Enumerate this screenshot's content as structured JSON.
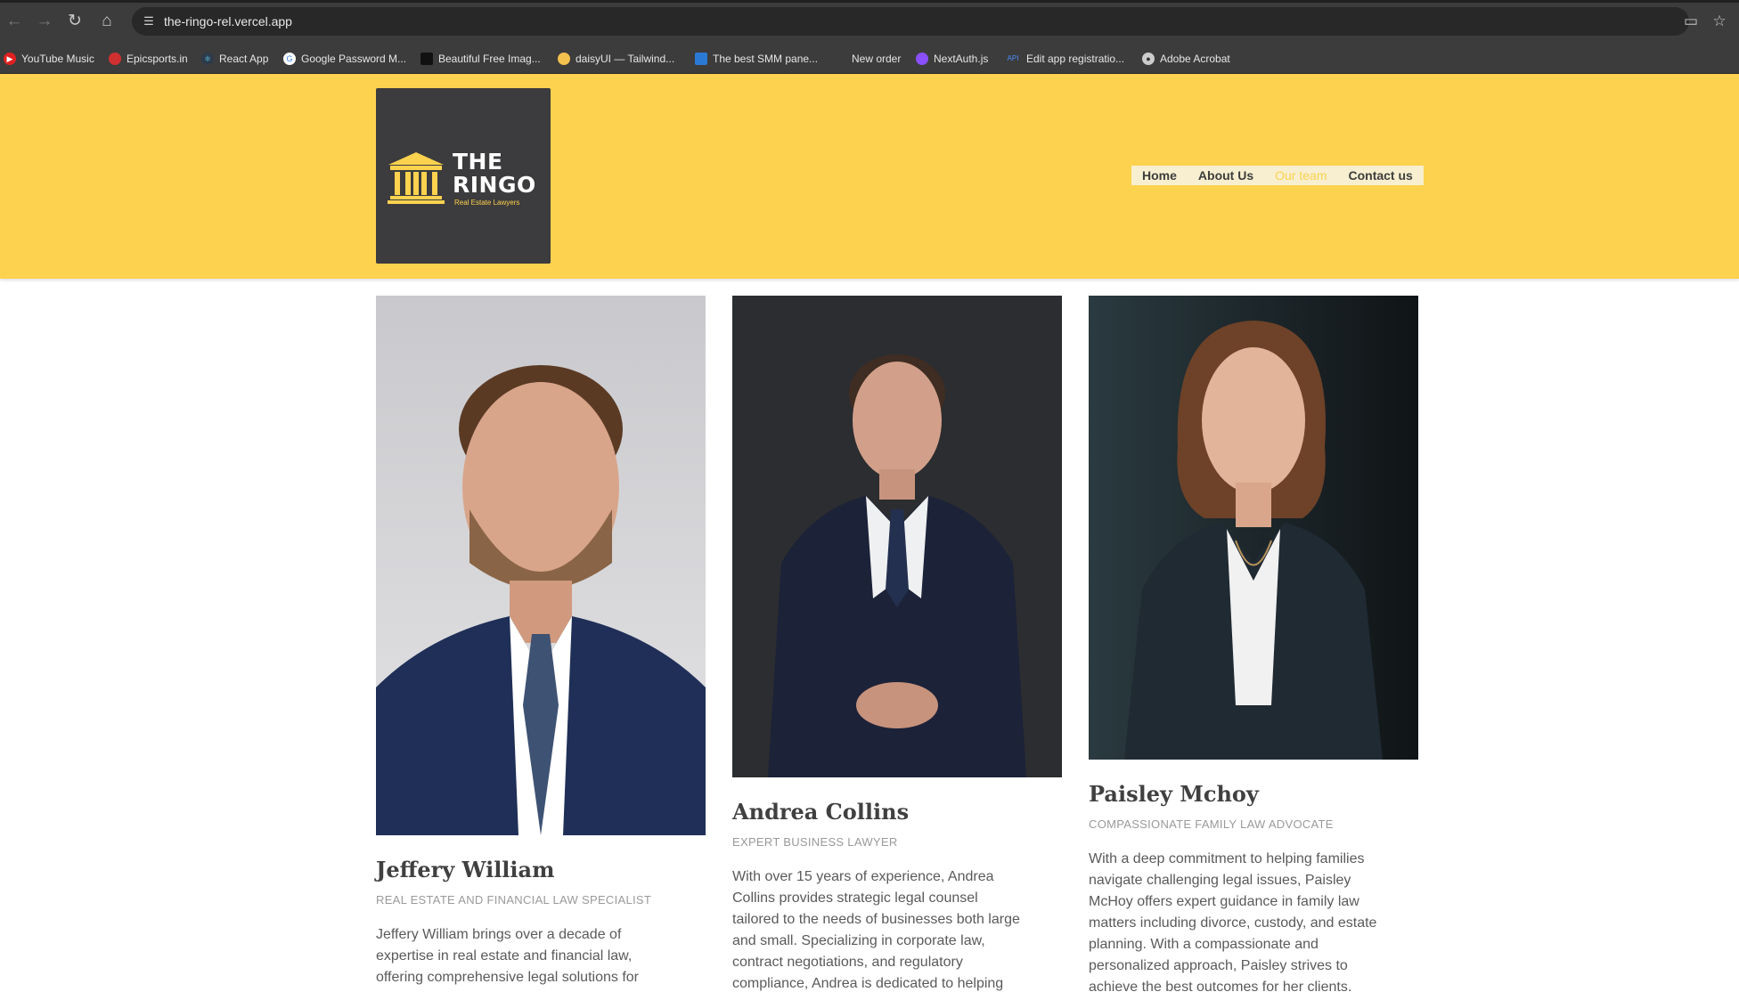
{
  "browser": {
    "url": "the-ringo-rel.vercel.app",
    "back_icon": "arrow-left-icon",
    "forward_icon": "arrow-right-icon",
    "reload_icon": "reload-icon",
    "home_icon": "home-icon"
  },
  "bookmarks": [
    {
      "label": "YouTube Music",
      "color": "#e02020"
    },
    {
      "label": "Epicsports.in",
      "color": "#d03030"
    },
    {
      "label": "React App",
      "color": "#3a6ea5"
    },
    {
      "label": "Google Password M...",
      "color": "#ffffff"
    },
    {
      "label": "Beautiful Free Imag...",
      "color": "#222222"
    },
    {
      "label": "daisyUI — Tailwind...",
      "color": "#f2c14e"
    },
    {
      "label": "The best SMM pane...",
      "color": "#2a7ad5"
    },
    {
      "label": "New order",
      "color": ""
    },
    {
      "label": "NextAuth.js",
      "color": "#8a4fff"
    },
    {
      "label": "Edit app registratio...",
      "color": "#4a8cff"
    },
    {
      "label": "Adobe Acrobat",
      "color": "#cccccc"
    }
  ],
  "header": {
    "brand_line1": "THE",
    "brand_line2": "RINGO",
    "tagline": "Real Estate Lawyers",
    "accent_color": "#fcd24f",
    "logo_bg": "#3c3b3d"
  },
  "nav": [
    {
      "label": "Home",
      "active": false
    },
    {
      "label": "About Us",
      "active": false
    },
    {
      "label": "Our team",
      "active": true
    },
    {
      "label": "Contact us",
      "active": false
    }
  ],
  "team": [
    {
      "name": "Jeffery William",
      "role": "REAL ESTATE AND FINANCIAL LAW SPECIALIST",
      "bio": "Jeffery William brings over a decade of expertise in real estate and financial law, offering comprehensive legal solutions for"
    },
    {
      "name": "Andrea Collins",
      "role": "EXPERT BUSINESS LAWYER",
      "bio": "With over 15 years of experience, Andrea Collins provides strategic legal counsel tailored to the needs of businesses both large and small. Specializing in corporate law, contract negotiations, and regulatory compliance, Andrea is dedicated to helping"
    },
    {
      "name": "Paisley Mchoy",
      "role": "COMPASSIONATE FAMILY LAW ADVOCATE",
      "bio": "With a deep commitment to helping families navigate challenging legal issues, Paisley McHoy offers expert guidance in family law matters including divorce, custody, and estate planning. With a compassionate and personalized approach, Paisley strives to achieve the best outcomes for her clients."
    }
  ]
}
